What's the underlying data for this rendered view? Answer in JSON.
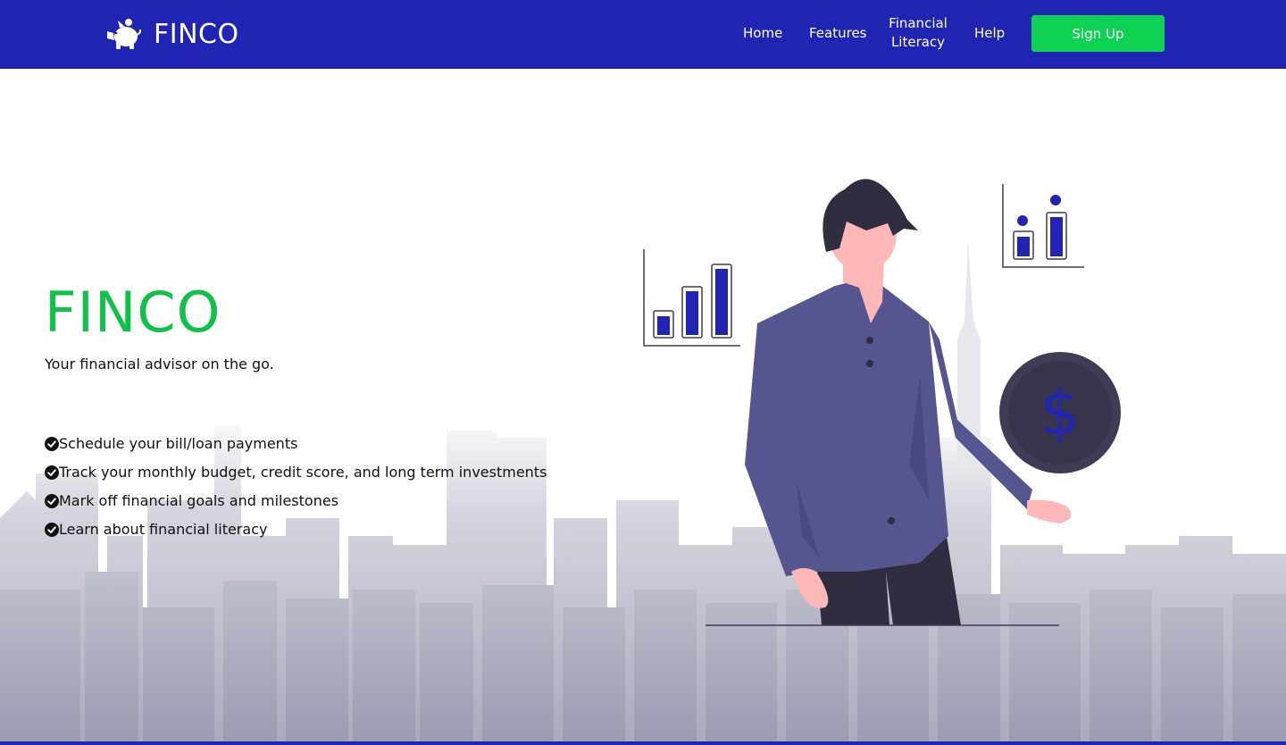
{
  "header": {
    "brand": "FINCO",
    "nav": {
      "home": "Home",
      "features": "Features",
      "literacy": "Financial Literacy",
      "help": "Help"
    },
    "signup_label": "Sign Up"
  },
  "hero": {
    "title": "FINCO",
    "subtitle": "Your financial advisor on the go.",
    "features": [
      "Schedule your bill/loan payments",
      "Track your monthly budget, credit score, and long term investments",
      "Mark off financial goals and milestones",
      "Learn about financial literacy"
    ]
  },
  "colors": {
    "nav_bg": "#1f24b2",
    "accent_green": "#10c14a",
    "signup_green": "#0fd154",
    "shirt": "#575590",
    "coin": "#3f3d56"
  },
  "icons": {
    "brand": "piggy-bank-icon",
    "feature_bullet": "check-circle-icon",
    "coin": "dollar-icon"
  }
}
